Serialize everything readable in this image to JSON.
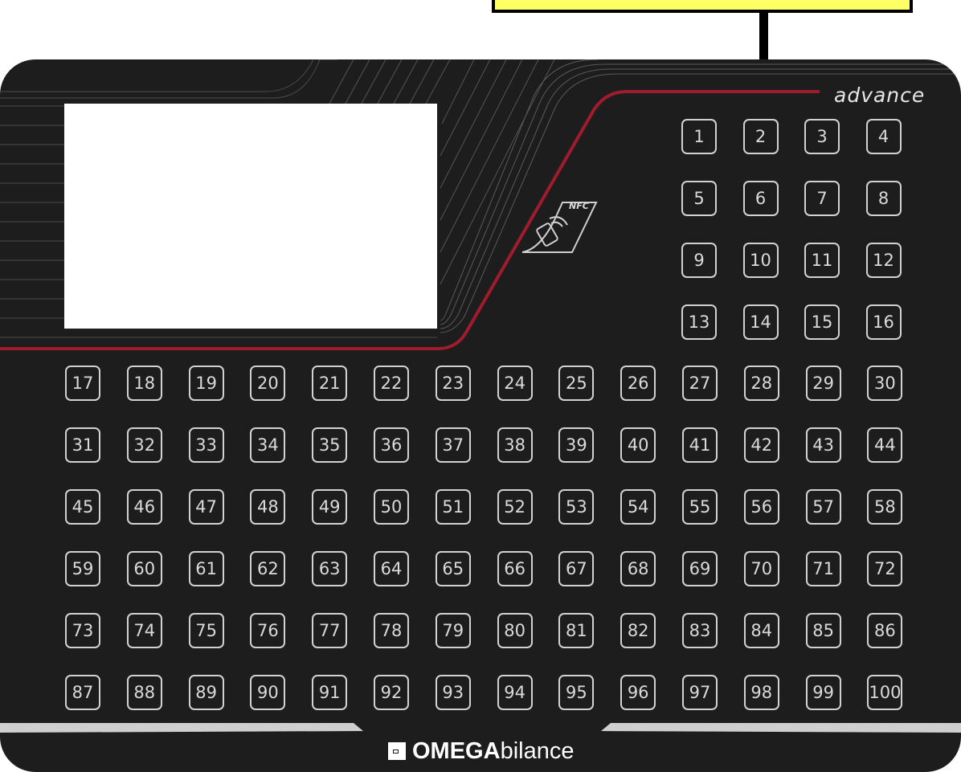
{
  "callout": {
    "text": ""
  },
  "panel": {
    "model_label": "advance",
    "nfc_label": "NFC",
    "brand": {
      "bold": "OMEGA",
      "light": "bilance"
    },
    "colors": {
      "panel": "#1d1d1d",
      "accent_red": "#a01c2c",
      "key_border": "#d2d2d2"
    }
  },
  "keys": {
    "top_grid": [
      "1",
      "2",
      "3",
      "4",
      "5",
      "6",
      "7",
      "8",
      "9",
      "10",
      "11",
      "12",
      "13",
      "14",
      "15",
      "16"
    ],
    "main_grid": [
      "17",
      "18",
      "19",
      "20",
      "21",
      "22",
      "23",
      "24",
      "25",
      "26",
      "27",
      "28",
      "29",
      "30",
      "31",
      "32",
      "33",
      "34",
      "35",
      "36",
      "37",
      "38",
      "39",
      "40",
      "41",
      "42",
      "43",
      "44",
      "45",
      "46",
      "47",
      "48",
      "49",
      "50",
      "51",
      "52",
      "53",
      "54",
      "55",
      "56",
      "57",
      "58",
      "59",
      "60",
      "61",
      "62",
      "63",
      "64",
      "65",
      "66",
      "67",
      "68",
      "69",
      "70",
      "71",
      "72",
      "73",
      "74",
      "75",
      "76",
      "77",
      "78",
      "79",
      "80",
      "81",
      "82",
      "83",
      "84",
      "85",
      "86",
      "87",
      "88",
      "89",
      "90",
      "91",
      "92",
      "93",
      "94",
      "95",
      "96",
      "97",
      "98",
      "99",
      "100"
    ]
  }
}
